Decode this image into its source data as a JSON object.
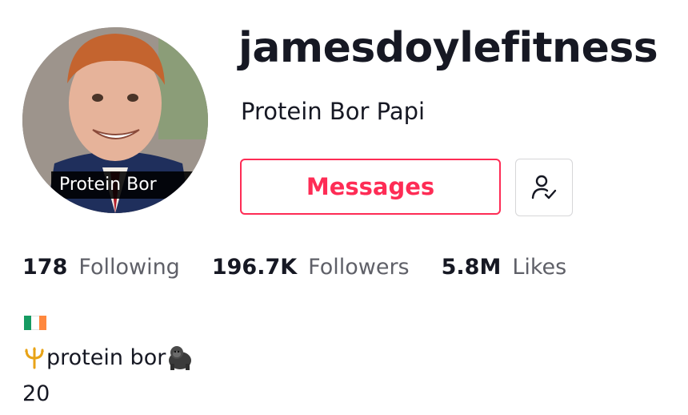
{
  "profile": {
    "username": "jamesdoylefitness",
    "nickname": "Protein Bor Papi",
    "avatar_caption": "Protein Bor"
  },
  "actions": {
    "messages_label": "Messages",
    "follow_icon": "user-check-icon"
  },
  "stats": [
    {
      "value": "178",
      "label": "Following"
    },
    {
      "value": "196.7K",
      "label": "Followers"
    },
    {
      "value": "5.8M",
      "label": "Likes"
    }
  ],
  "bio": {
    "flag": "ireland-flag",
    "line1_text": "protein bor",
    "line1_prefix_icon": "trident-icon",
    "line1_suffix_icon": "gorilla-icon",
    "line2": "20"
  },
  "colors": {
    "accent": "#fe2c55",
    "text": "#161823",
    "secondary_text": "#5f6068",
    "border": "#d6d6d8",
    "flag_green": "#169b62",
    "flag_white": "#ffffff",
    "flag_orange": "#ff883e"
  }
}
